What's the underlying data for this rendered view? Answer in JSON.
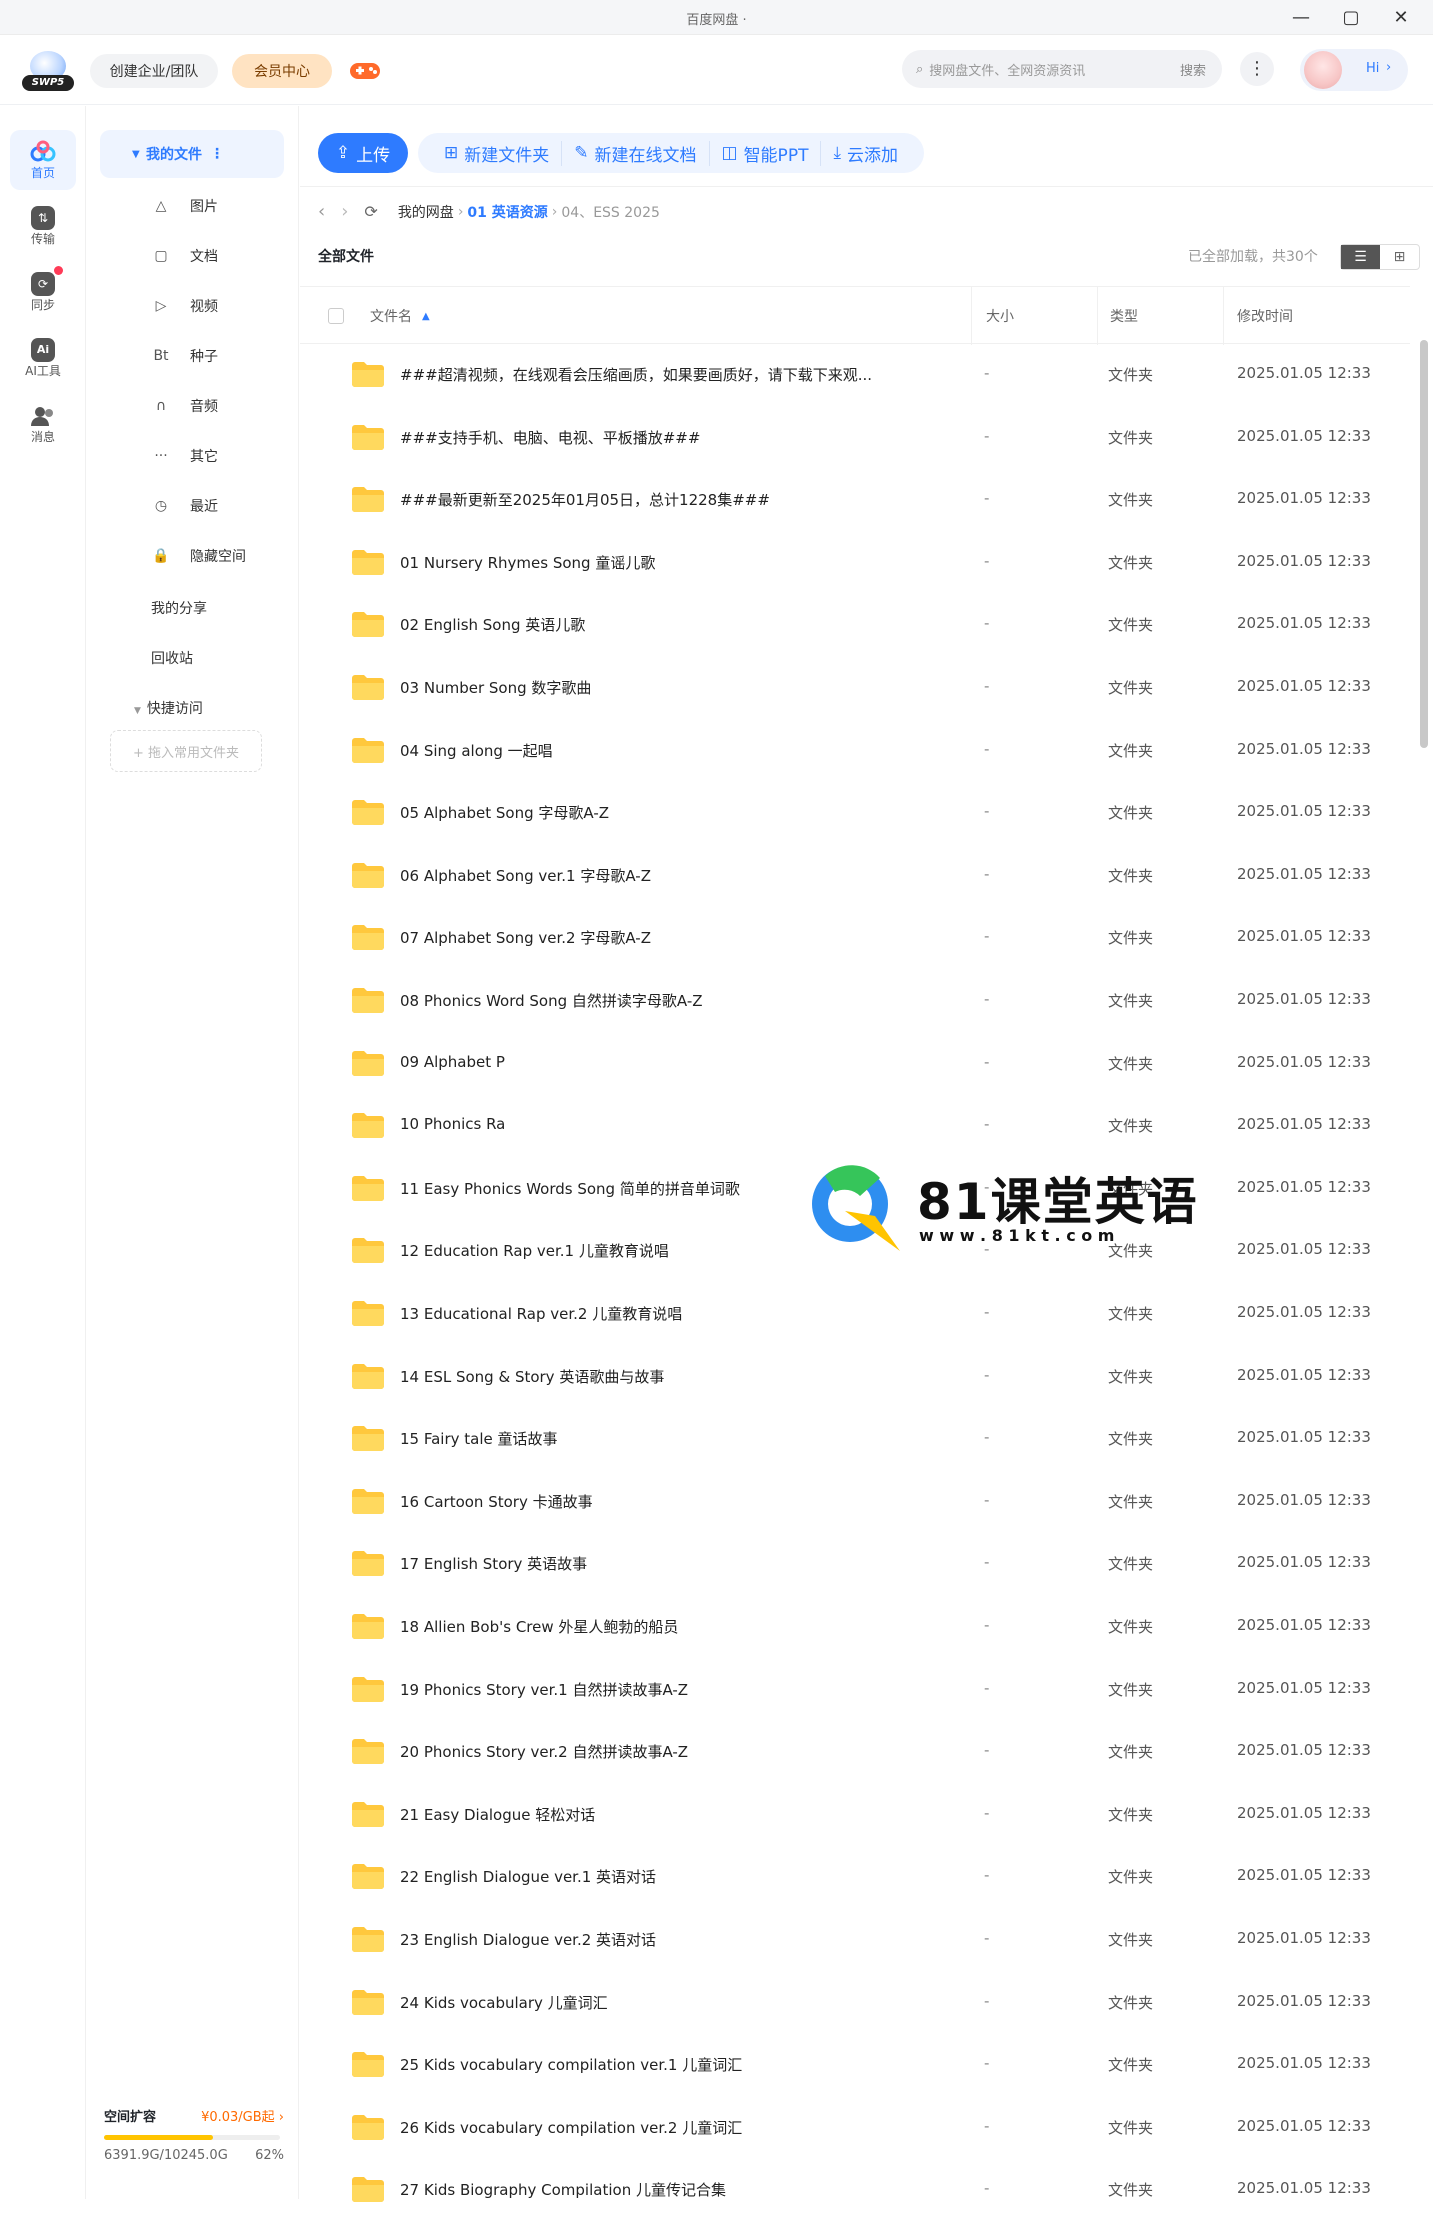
{
  "window": {
    "title": "百度网盘 ·"
  },
  "topbar": {
    "logo_text": "SWP5",
    "enterprise_label": "创建企业/团队",
    "vip_label": "会员中心",
    "search_placeholder": "搜网盘文件、全网资源资讯",
    "search_button": "搜索",
    "hi_label": "Hi"
  },
  "rail": [
    {
      "label": "首页",
      "icon": "home-icon"
    },
    {
      "label": "传输",
      "icon": "transfer-icon"
    },
    {
      "label": "同步",
      "icon": "sync-icon"
    },
    {
      "label": "AI工具",
      "icon": "ai-icon"
    },
    {
      "label": "消息",
      "icon": "message-icon"
    }
  ],
  "sidebar": {
    "myfiles": "我的文件",
    "items": [
      {
        "icon": "△",
        "label": "图片"
      },
      {
        "icon": "▢",
        "label": "文档"
      },
      {
        "icon": "▷",
        "label": "视频"
      },
      {
        "icon": "Bt",
        "label": "种子"
      },
      {
        "icon": "∩",
        "label": "音频"
      },
      {
        "icon": "···",
        "label": "其它"
      },
      {
        "icon": "◷",
        "label": "最近"
      },
      {
        "icon": "🔒",
        "label": "隐藏空间"
      }
    ],
    "share": "我的分享",
    "trash": "回收站",
    "quick": "快捷访问",
    "drop_hint": "+ 拖入常用文件夹",
    "expand_label": "空间扩容",
    "expand_price": "¥0.03/GB起",
    "usage": "6391.9G/10245.0G",
    "usage_pct": "62%",
    "usage_fraction": 0.62
  },
  "toolbar": {
    "upload": "上传",
    "new_folder": "新建文件夹",
    "new_doc": "新建在线文档",
    "ppt": "智能PPT",
    "cloud_add": "云添加"
  },
  "breadcrumb": {
    "root": "我的网盘",
    "level1": "01 英语资源",
    "level2": "04、ESS 2025"
  },
  "list": {
    "title": "全部文件",
    "status": "已全部加载，共30个",
    "columns": {
      "name": "文件名",
      "size": "大小",
      "type": "类型",
      "time": "修改时间"
    },
    "rows": [
      {
        "name": "###超清视频，在线观看会压缩画质，如果要画质好，请下载下来观...",
        "size": "-",
        "type": "文件夹",
        "time": "2025.01.05 12:33"
      },
      {
        "name": "###支持手机、电脑、电视、平板播放###",
        "size": "-",
        "type": "文件夹",
        "time": "2025.01.05 12:33"
      },
      {
        "name": "###最新更新至2025年01月05日，总计1228集###",
        "size": "-",
        "type": "文件夹",
        "time": "2025.01.05 12:33"
      },
      {
        "name": "01 Nursery Rhymes Song 童谣儿歌",
        "size": "-",
        "type": "文件夹",
        "time": "2025.01.05 12:33"
      },
      {
        "name": "02 English Song 英语儿歌",
        "size": "-",
        "type": "文件夹",
        "time": "2025.01.05 12:33"
      },
      {
        "name": "03 Number Song 数字歌曲",
        "size": "-",
        "type": "文件夹",
        "time": "2025.01.05 12:33"
      },
      {
        "name": "04 Sing along 一起唱",
        "size": "-",
        "type": "文件夹",
        "time": "2025.01.05 12:33"
      },
      {
        "name": "05 Alphabet Song 字母歌A-Z",
        "size": "-",
        "type": "文件夹",
        "time": "2025.01.05 12:33"
      },
      {
        "name": "06 Alphabet Song ver.1 字母歌A-Z",
        "size": "-",
        "type": "文件夹",
        "time": "2025.01.05 12:33"
      },
      {
        "name": "07 Alphabet Song ver.2 字母歌A-Z",
        "size": "-",
        "type": "文件夹",
        "time": "2025.01.05 12:33"
      },
      {
        "name": "08 Phonics Word Song 自然拼读字母歌A-Z",
        "size": "-",
        "type": "文件夹",
        "time": "2025.01.05 12:33"
      },
      {
        "name": "09 Alphabet P",
        "size": "-",
        "type": "文件夹",
        "time": "2025.01.05 12:33"
      },
      {
        "name": "10 Phonics Ra",
        "size": "-",
        "type": "文件夹",
        "time": "2025.01.05 12:33"
      },
      {
        "name": "11 Easy Phonics Words Song 简单的拼音单词歌",
        "size": "-",
        "type": "文件夹",
        "time": "2025.01.05 12:33"
      },
      {
        "name": "12 Education Rap ver.1 儿童教育说唱",
        "size": "-",
        "type": "文件夹",
        "time": "2025.01.05 12:33"
      },
      {
        "name": "13 Educational Rap ver.2 儿童教育说唱",
        "size": "-",
        "type": "文件夹",
        "time": "2025.01.05 12:33"
      },
      {
        "name": "14 ESL Song & Story 英语歌曲与故事",
        "size": "-",
        "type": "文件夹",
        "time": "2025.01.05 12:33"
      },
      {
        "name": "15 Fairy tale 童话故事",
        "size": "-",
        "type": "文件夹",
        "time": "2025.01.05 12:33"
      },
      {
        "name": "16 Cartoon Story 卡通故事",
        "size": "-",
        "type": "文件夹",
        "time": "2025.01.05 12:33"
      },
      {
        "name": "17 English Story 英语故事",
        "size": "-",
        "type": "文件夹",
        "time": "2025.01.05 12:33"
      },
      {
        "name": "18 Allien Bob's Crew 外星人鲍勃的船员",
        "size": "-",
        "type": "文件夹",
        "time": "2025.01.05 12:33"
      },
      {
        "name": "19 Phonics Story ver.1 自然拼读故事A-Z",
        "size": "-",
        "type": "文件夹",
        "time": "2025.01.05 12:33"
      },
      {
        "name": "20 Phonics Story ver.2 自然拼读故事A-Z",
        "size": "-",
        "type": "文件夹",
        "time": "2025.01.05 12:33"
      },
      {
        "name": "21 Easy Dialogue 轻松对话",
        "size": "-",
        "type": "文件夹",
        "time": "2025.01.05 12:33"
      },
      {
        "name": "22 English Dialogue ver.1 英语对话",
        "size": "-",
        "type": "文件夹",
        "time": "2025.01.05 12:33"
      },
      {
        "name": "23 English Dialogue ver.2 英语对话",
        "size": "-",
        "type": "文件夹",
        "time": "2025.01.05 12:33"
      },
      {
        "name": "24 Kids vocabulary 儿童词汇",
        "size": "-",
        "type": "文件夹",
        "time": "2025.01.05 12:33"
      },
      {
        "name": "25 Kids vocabulary compilation ver.1 儿童词汇",
        "size": "-",
        "type": "文件夹",
        "time": "2025.01.05 12:33"
      },
      {
        "name": "26 Kids vocabulary compilation ver.2 儿童词汇",
        "size": "-",
        "type": "文件夹",
        "time": "2025.01.05 12:33"
      },
      {
        "name": "27 Kids Biography Compilation 儿童传记合集",
        "size": "-",
        "type": "文件夹",
        "time": "2025.01.05 12:33"
      }
    ]
  },
  "watermark": {
    "title": "81课堂英语",
    "url": "w w w . 8 1 k t . c o m"
  },
  "colors": {
    "accent": "#2e7bff",
    "folder": "#ffc83d",
    "vip": "#ffe3c2"
  }
}
